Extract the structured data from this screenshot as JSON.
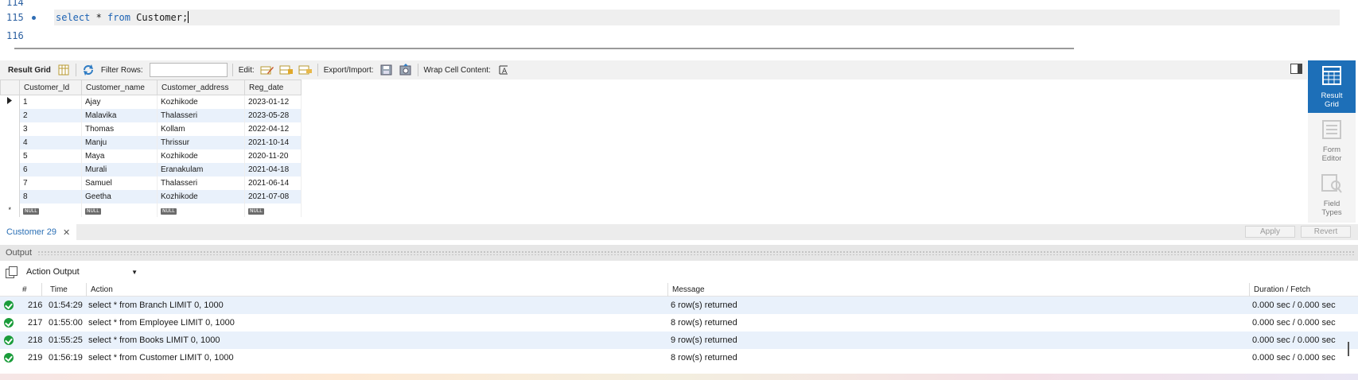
{
  "editor": {
    "lines": [
      {
        "num": "114",
        "code": ""
      },
      {
        "num": "115",
        "kw1": "select",
        "mid": " * ",
        "kw2": "from",
        "rest": " Customer;"
      },
      {
        "num": "116",
        "code": ""
      }
    ]
  },
  "result_toolbar": {
    "result_grid_label": "Result Grid",
    "filter_label": "Filter Rows:",
    "filter_value": "",
    "edit_label": "Edit:",
    "export_label": "Export/Import:",
    "wrap_label": "Wrap Cell Content:"
  },
  "grid": {
    "columns": [
      "Customer_Id",
      "Customer_name",
      "Customer_address",
      "Reg_date"
    ],
    "rows": [
      [
        "1",
        "Ajay",
        "Kozhikode",
        "2023-01-12"
      ],
      [
        "2",
        "Malavika",
        "Thalasseri",
        "2023-05-28"
      ],
      [
        "3",
        "Thomas",
        "Kollam",
        "2022-04-12"
      ],
      [
        "4",
        "Manju",
        "Thrissur",
        "2021-10-14"
      ],
      [
        "5",
        "Maya",
        "Kozhikode",
        "2020-11-20"
      ],
      [
        "6",
        "Murali",
        "Eranakulam",
        "2021-04-18"
      ],
      [
        "7",
        "Samuel",
        "Thalasseri",
        "2021-06-14"
      ],
      [
        "8",
        "Geetha",
        "Kozhikode",
        "2021-07-08"
      ]
    ],
    "null_label": "NULL",
    "new_row_marker": "*"
  },
  "side_panel": {
    "result_grid": "Result\nGrid",
    "form_editor": "Form\nEditor",
    "field_types": "Field\nTypes"
  },
  "tab_bar": {
    "tab_label": "Customer 29",
    "close_glyph": "✕",
    "apply_label": "Apply",
    "revert_label": "Revert"
  },
  "output": {
    "header_title": "Output",
    "selector_value": "Action Output",
    "columns": [
      "#",
      "Time",
      "Action",
      "Message",
      "Duration / Fetch"
    ],
    "rows": [
      {
        "num": "216",
        "time": "01:54:29",
        "action": "select * from Branch LIMIT 0, 1000",
        "message": "6 row(s) returned",
        "duration": "0.000 sec / 0.000 sec"
      },
      {
        "num": "217",
        "time": "01:55:00",
        "action": "select * from Employee LIMIT 0, 1000",
        "message": "8 row(s) returned",
        "duration": "0.000 sec / 0.000 sec"
      },
      {
        "num": "218",
        "time": "01:55:25",
        "action": "select * from Books LIMIT 0, 1000",
        "message": "9 row(s) returned",
        "duration": "0.000 sec / 0.000 sec"
      },
      {
        "num": "219",
        "time": "01:56:19",
        "action": "select * from Customer LIMIT 0, 1000",
        "message": "8 row(s) returned",
        "duration": "0.000 sec / 0.000 sec"
      }
    ]
  },
  "colors": {
    "accent": "#1d6fb8",
    "keyword": "#1d63b4",
    "row_alt": "#e9f1fb",
    "success": "#1a9c3a"
  }
}
